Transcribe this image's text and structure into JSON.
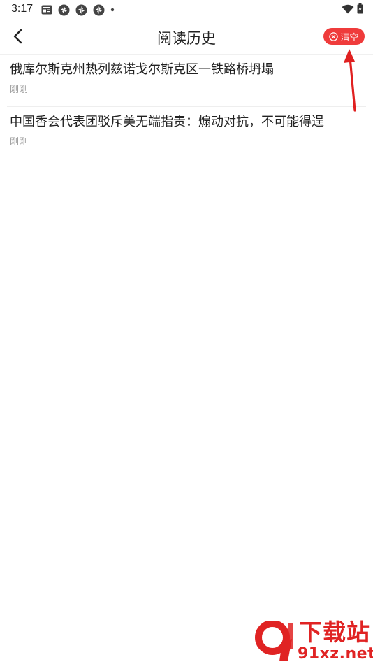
{
  "status_bar": {
    "time": "3:17",
    "left_icons": [
      "newspaper-app-icon",
      "aperture-app-icon",
      "aperture-app-icon",
      "aperture-app-icon",
      "more-dot-icon"
    ],
    "right_icons": [
      "wifi-icon",
      "battery-icon"
    ]
  },
  "header": {
    "back_icon": "chevron-left-icon",
    "title": "阅读历史",
    "clear_icon": "circle-close-icon",
    "clear_label": "清空"
  },
  "history": {
    "items": [
      {
        "title": "俄库尔斯克州热列兹诺戈尔斯克区一铁路桥坍塌",
        "time": "刚刚"
      },
      {
        "title": "中国香会代表团驳斥美无端指责：煽动对抗，不可能得逞",
        "time": "刚刚"
      }
    ]
  },
  "annotation": {
    "arrow_color": "#e02020"
  },
  "watermark": {
    "logo_text": "9",
    "name": "下载站",
    "domain": "91xz.net",
    "color": "#e02323"
  },
  "colors": {
    "accent": "#ef3b3b",
    "text_primary": "#222222",
    "text_secondary": "#9a9a9a",
    "divider": "#eeeeee"
  }
}
